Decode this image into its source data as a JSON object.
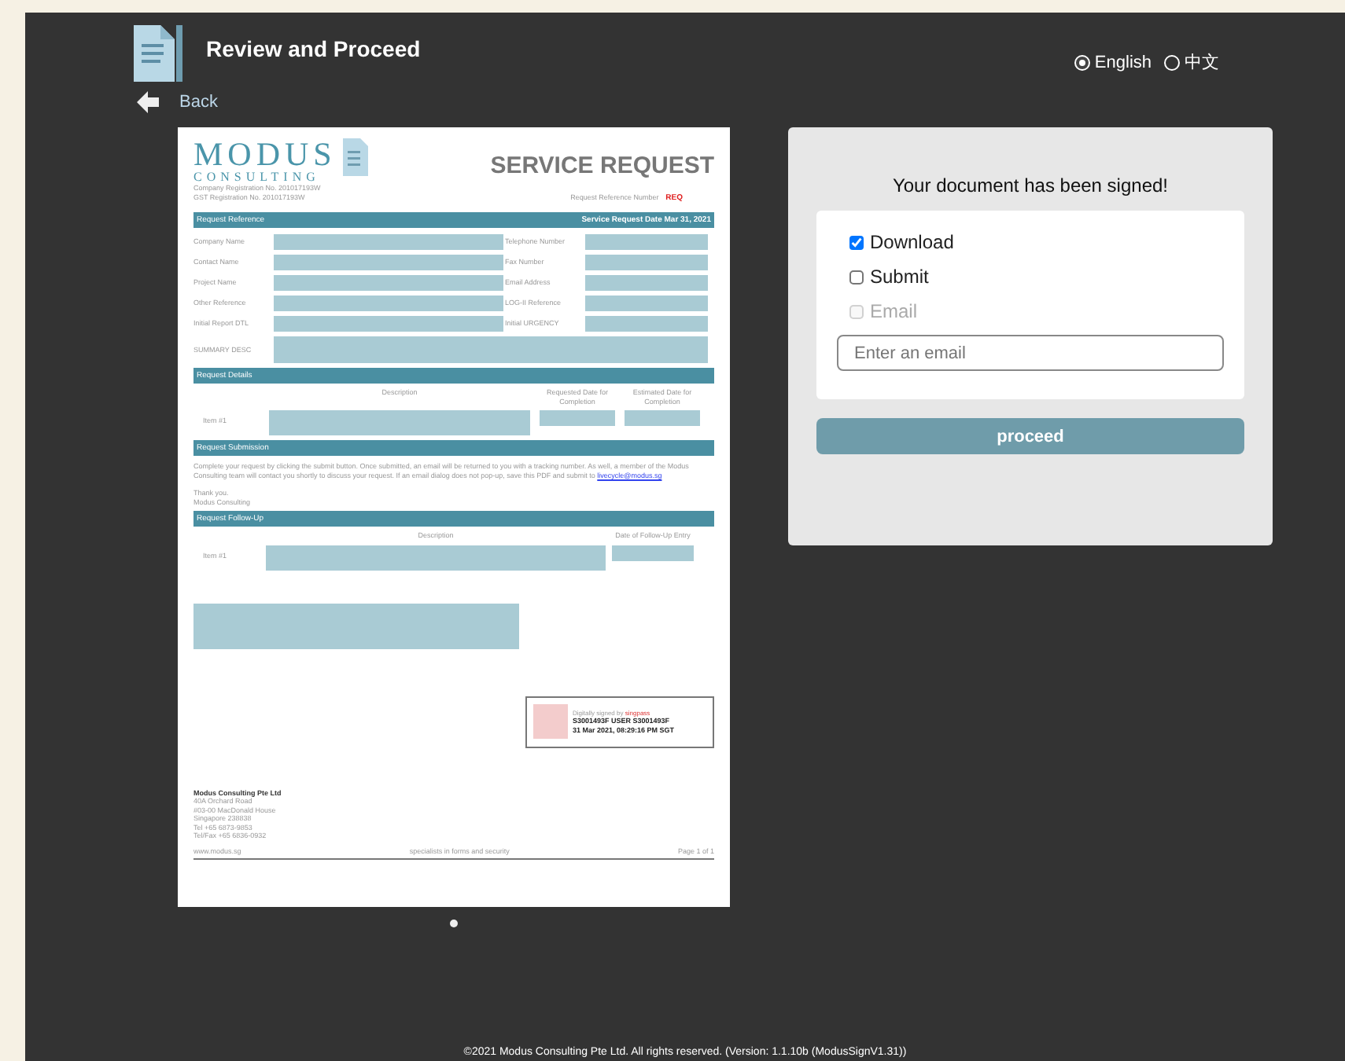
{
  "header": {
    "title": "Review and Proceed",
    "back": "Back",
    "languages": [
      {
        "label": "English",
        "selected": true
      },
      {
        "label": "中文",
        "selected": false
      }
    ]
  },
  "document": {
    "brand": "MODUS",
    "brand_sub": "CONSULTING",
    "heading": "SERVICE REQUEST",
    "registration": [
      "Company Registration No. 201017193W",
      "GST Registration No.      201017193W"
    ],
    "reference_label": "Request Reference Number",
    "reference_value": "REQ",
    "reference_bar": {
      "title": "Request Reference",
      "date": "Service Request Date Mar 31, 2021"
    },
    "fields": [
      {
        "left": "Company Name",
        "right": "Telephone Number"
      },
      {
        "left": "Contact Name",
        "right": "Fax Number"
      },
      {
        "left": "Project Name",
        "right": "Email Address"
      },
      {
        "left": "Other Reference",
        "right": "LOG-II Reference"
      },
      {
        "left": "Initial Report DTL",
        "right": "Initial URGENCY"
      }
    ],
    "summary_label": "SUMMARY DESC",
    "details": {
      "title": "Request Details",
      "columns": [
        "Description",
        "Requested Date for Completion",
        "Estimated Date for Completion"
      ],
      "item": "Item #1"
    },
    "submission": {
      "title": "Request Submission",
      "text": "Complete your request by clicking the submit button. Once submitted, an email will be returned to you with a tracking number. As well, a member of the Modus Consulting team will contact you shortly to discuss your request. If an email dialog does not pop-up, save this PDF and submit to",
      "link": "livecycle@modus.sg",
      "closing": [
        "Thank you.",
        "Modus Consulting"
      ]
    },
    "followup": {
      "title": "Request Follow-Up",
      "columns": [
        "Description",
        "Date of Follow-Up Entry"
      ],
      "item": "Item #1"
    },
    "signature": {
      "signed_by": "Digitally signed by",
      "provider": "singpass",
      "user": "S3001493F USER S3001493F",
      "date": "31 Mar 2021, 08:29:16 PM SGT"
    },
    "address": [
      "Modus Consulting Pte Ltd",
      "40A Orchard Road",
      "#03-00 MacDonald House",
      "Singapore 238838",
      "Tel        +65 6873-9853",
      "Tel/Fax   +65 6836-0932"
    ],
    "footer": {
      "website": "www.modus.sg",
      "tagline": "specialists in forms and security",
      "page": "Page 1 of 1"
    }
  },
  "pager": [
    {
      "selected": true
    }
  ],
  "card": {
    "message": "Your document has been signed!",
    "options": [
      {
        "label": "Download",
        "checked": true,
        "disabled": false
      },
      {
        "label": "Submit",
        "checked": false,
        "disabled": false
      },
      {
        "label": "Email",
        "checked": false,
        "disabled": true
      }
    ],
    "email": {
      "placeholder": "Enter an email"
    },
    "button": "proceed"
  },
  "copyright": "©2021 Modus Consulting Pte Ltd. All rights reserved. (Version: 1.1.10b (ModusSignV1.31))"
}
